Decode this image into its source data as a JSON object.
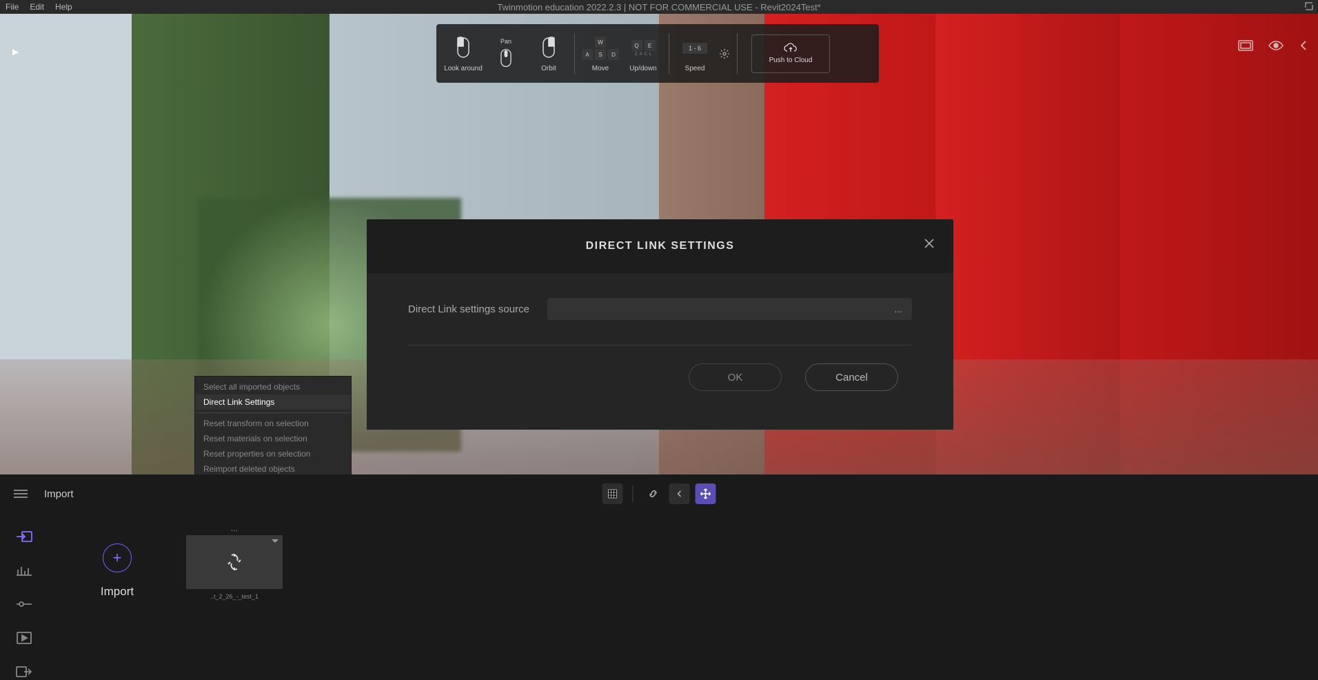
{
  "menubar": {
    "items": [
      "File",
      "Edit",
      "Help"
    ],
    "title": "Twinmotion education 2022.2.3 | NOT FOR COMMERCIAL USE - Revit2024Test*"
  },
  "navHints": {
    "lookAround": "Look around",
    "panTop": "Pan",
    "orbit": "Orbit",
    "move": "Move",
    "updown": "Up/down",
    "speed": "Speed",
    "speedKeys": "1 - 6",
    "pushCloud": "Push to Cloud",
    "moveKeys": {
      "top": "W",
      "row": [
        "A",
        "S",
        "D"
      ]
    },
    "updownKeys": {
      "top": [
        "Q",
        "E"
      ],
      "row": [
        "Z",
        "A",
        "C",
        "L"
      ]
    }
  },
  "contextMenu": {
    "items": [
      "Select all imported objects",
      "Direct Link Settings",
      "Reset transform on selection",
      "Reset materials on selection",
      "Reset properties on selection",
      "Reimport deleted objects"
    ],
    "activeIndex": 1
  },
  "modal": {
    "title": "DIRECT LINK SETTINGS",
    "fieldLabel": "Direct Link settings source",
    "browseEllipsis": "...",
    "ok": "OK",
    "cancel": "Cancel"
  },
  "sectionBar": {
    "label": "Import"
  },
  "bottom": {
    "importAction": "Import",
    "thumbEllipsis": "...",
    "thumbLabel": "..t_2_26_-_test_1"
  }
}
